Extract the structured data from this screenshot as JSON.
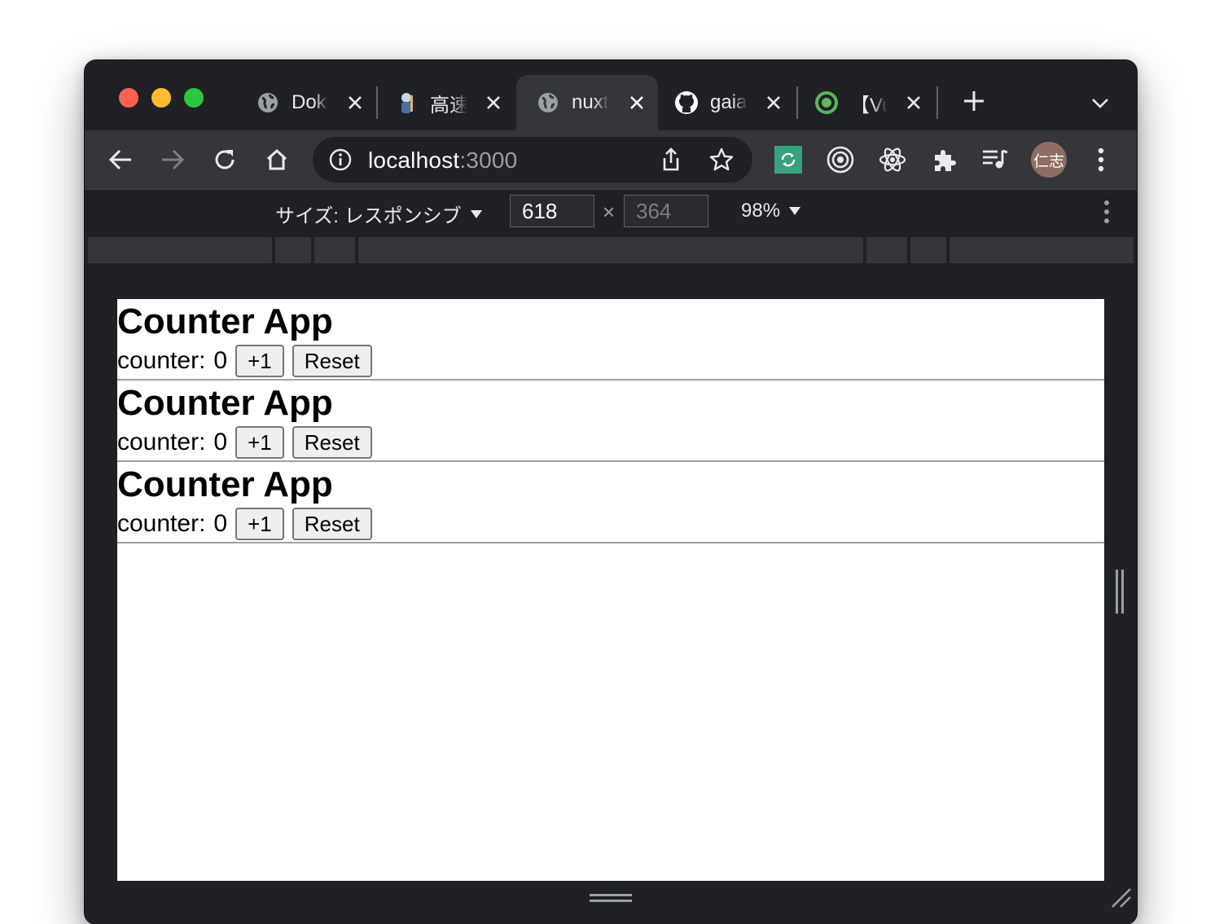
{
  "browser": {
    "tabs": [
      {
        "title": "Dok",
        "favicon": "globe-icon"
      },
      {
        "title": "高速",
        "favicon": "mascot-icon"
      },
      {
        "title": "nuxt",
        "favicon": "globe-icon",
        "active": true
      },
      {
        "title": "gaia",
        "favicon": "github-icon"
      },
      {
        "title": "【Vu",
        "favicon": "green-ring-icon"
      }
    ],
    "url_host": "localhost",
    "url_port": ":3000",
    "profile_initials": "仁志"
  },
  "devtools": {
    "size_label": "サイズ: レスポンシブ",
    "width": "618",
    "height_placeholder": "364",
    "times": "×",
    "zoom": "98%"
  },
  "app": {
    "counters": [
      {
        "title": "Counter App",
        "label": "counter:",
        "value": "0",
        "increment_label": "+1",
        "reset_label": "Reset"
      },
      {
        "title": "Counter App",
        "label": "counter:",
        "value": "0",
        "increment_label": "+1",
        "reset_label": "Reset"
      },
      {
        "title": "Counter App",
        "label": "counter:",
        "value": "0",
        "increment_label": "+1",
        "reset_label": "Reset"
      }
    ]
  },
  "colors": {
    "chrome_dark": "#202124",
    "toolbar": "#35363a",
    "text_light": "#e8eaed"
  }
}
